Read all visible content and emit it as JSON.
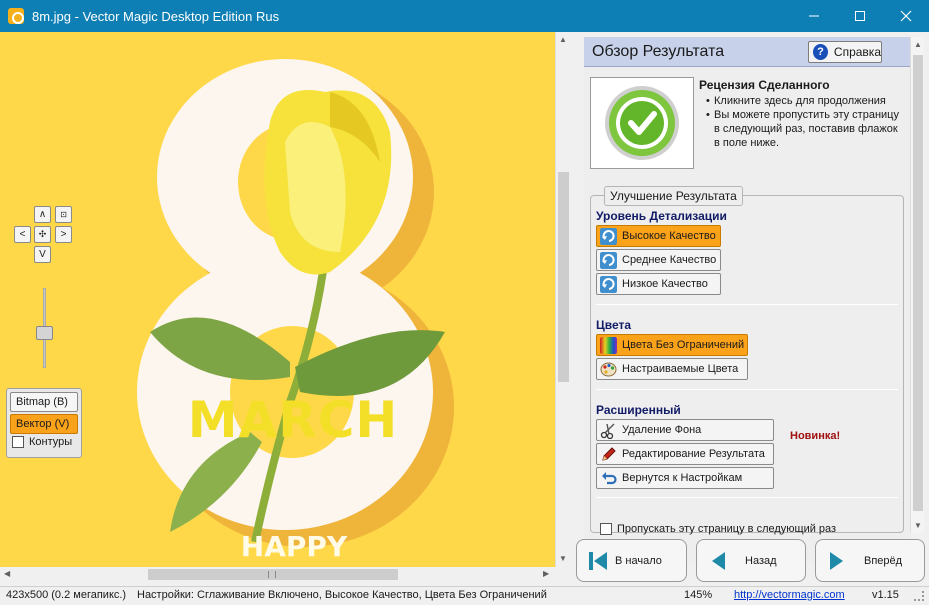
{
  "window": {
    "title": "8m.jpg - Vector Magic Desktop Edition Rus"
  },
  "image": {
    "march_text": "MARCH",
    "happy_text": "HAPPY"
  },
  "view_modes": {
    "bitmap_label": "Bitmap (B)",
    "vector_label": "Вектор (V)",
    "contours_label": "Контуры",
    "contours_checked": false
  },
  "panel": {
    "title": "Обзор Результата",
    "help_label": "Справка",
    "review": {
      "title": "Рецензия Сделанного",
      "bullets": [
        "Кликните здесь для продолжения",
        "Вы можете пропустить эту страницу в следующий раз, поставив флажок в поле ниже."
      ]
    },
    "improve_group_label": "Улучшение Результата",
    "detail": {
      "title": "Уровень Детализации",
      "buttons": [
        "Высокое Качество",
        "Среднее Качество",
        "Низкое Качество"
      ],
      "active_index": 0
    },
    "colors": {
      "title": "Цвета",
      "buttons": [
        "Цвета Без Ограничений",
        "Настраиваемые Цвета"
      ],
      "active_index": 0
    },
    "advanced": {
      "title": "Расширенный",
      "buttons": [
        "Удаление Фона",
        "Редактирование Результата",
        "Вернутся к Настройкам"
      ],
      "new_tag": "Новинка!"
    },
    "skip_label": "Пропускать эту страницу в следующий раз",
    "skip_checked": false
  },
  "nav": {
    "start_label": "В начало",
    "back_label": "Назад",
    "next_label": "Вперёд"
  },
  "status": {
    "size": "423x500 (0.2 мегапикс.)",
    "settings": "Настройки: Сглаживание Включено, Высокое Качество, Цвета Без Ограничений",
    "zoom": "145%",
    "link": "http://vectormagic.com",
    "version": "v1.15"
  },
  "colors": {
    "titlebar": "#0e7fb5",
    "accent_orange": "#f9a21a",
    "header_blue": "#c7d2ea",
    "canvas_yellow": "#ffd84a",
    "new_tag_red": "#a01010"
  }
}
